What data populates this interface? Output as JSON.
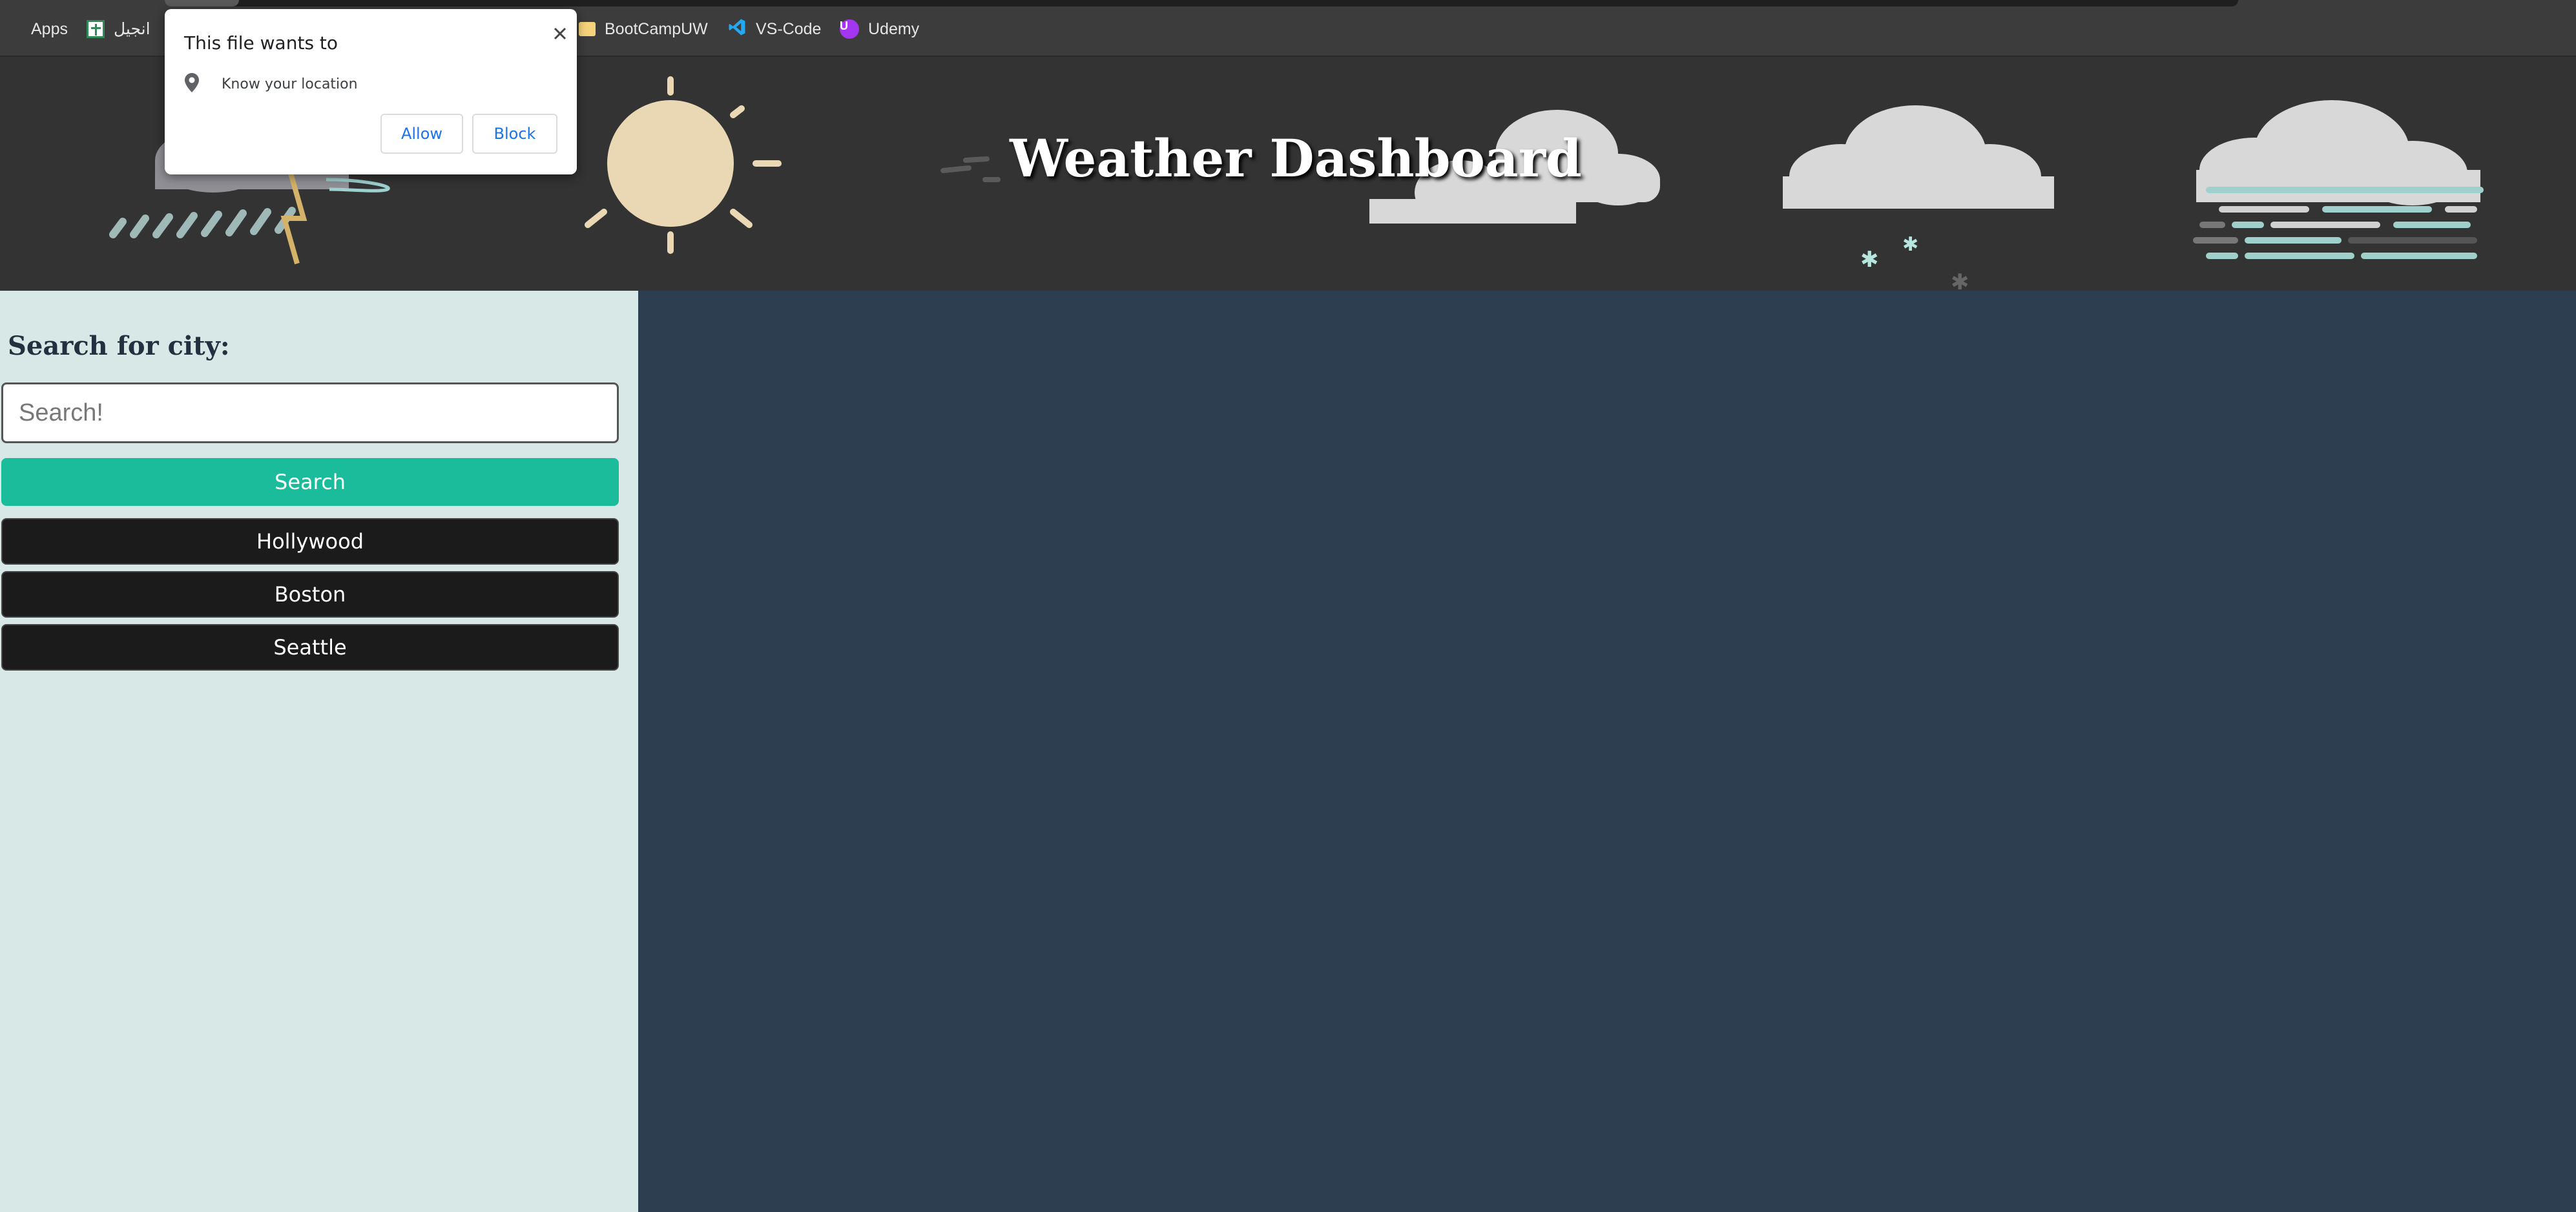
{
  "bookmarks": {
    "items": [
      {
        "label": "Apps"
      },
      {
        "label": "انجيل"
      },
      {
        "label": "BootCampUW"
      },
      {
        "label": "VS-Code"
      },
      {
        "label": "Udemy"
      }
    ]
  },
  "header": {
    "title": "Weather Dashboard"
  },
  "sidebar": {
    "heading": "Search for city:",
    "search_placeholder": "Search!",
    "search_button": "Search",
    "cities": [
      "Hollywood",
      "Boston",
      "Seattle"
    ]
  },
  "permission_popup": {
    "title": "This file wants to",
    "permission": "Know your location",
    "allow_label": "Allow",
    "block_label": "Block",
    "close_icon": "close-icon",
    "location_icon": "location-pin-icon"
  },
  "colors": {
    "main_bg": "#2c3e50",
    "sidebar_bg": "#d7e8e7",
    "search_button": "#1abc9c",
    "city_button": "#1b1b1b",
    "header_bg": "#333333",
    "link_blue": "#1a73e8"
  }
}
